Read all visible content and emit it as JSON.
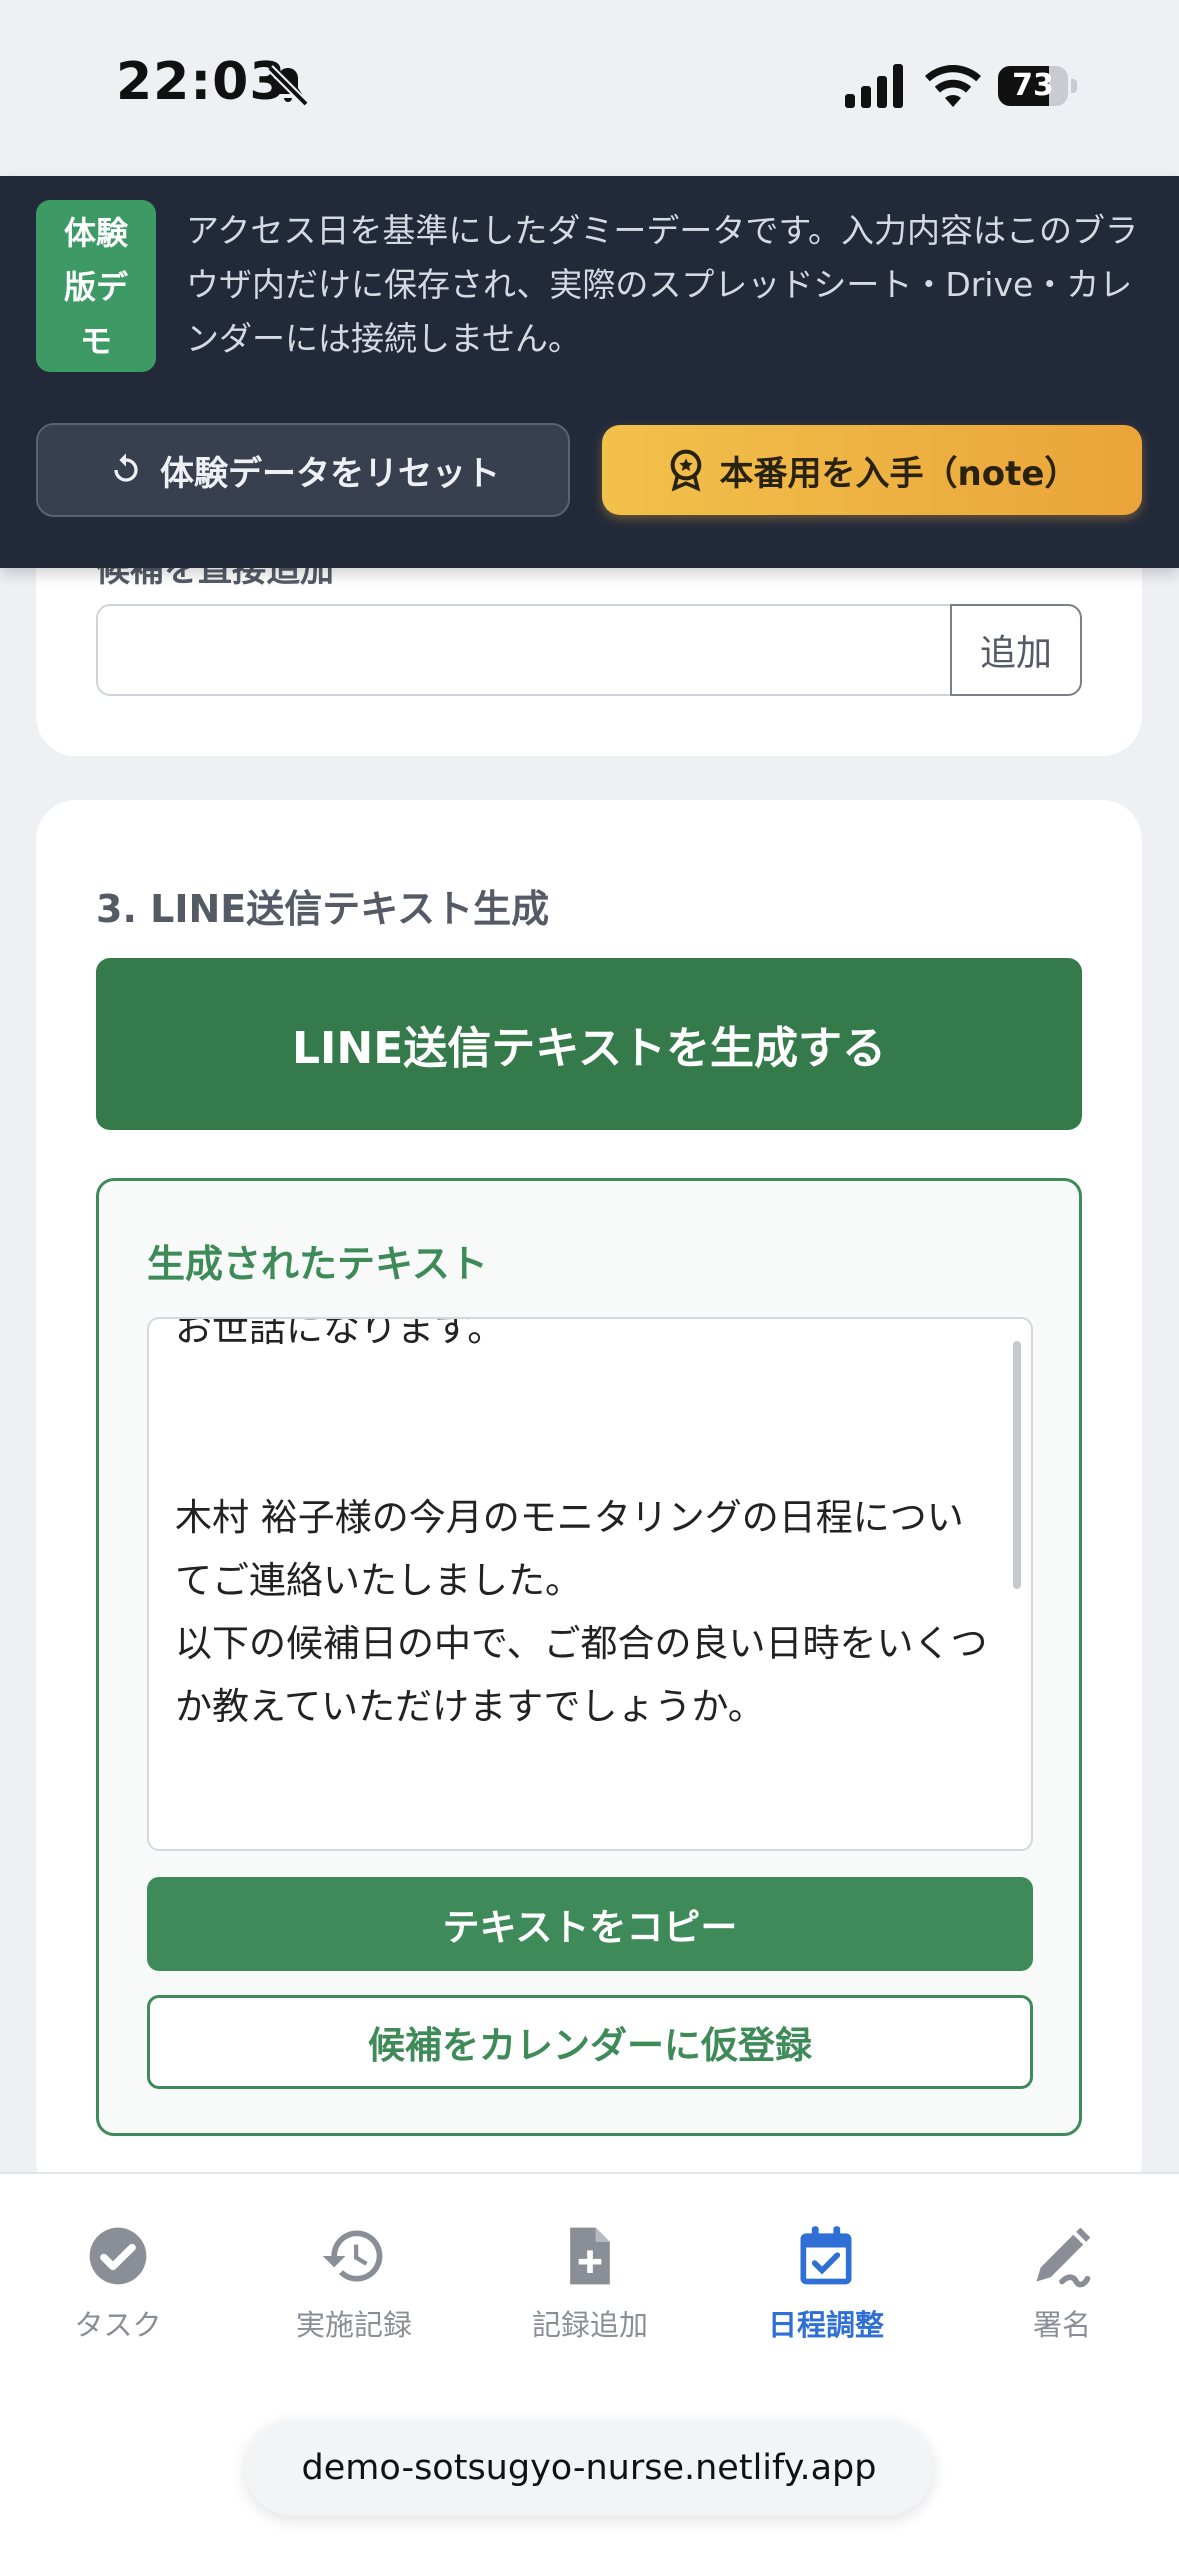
{
  "status_bar": {
    "time": "22:03",
    "battery": "73",
    "battery_level": 0.73
  },
  "banner": {
    "badge": [
      "体験",
      "版デ",
      "モ"
    ],
    "message": "アクセス日を基準にしたダミーデータです。入力内容はこのブラウザ内だけに保存され、実際のスプレッドシート・Drive・カレンダーには接続しません。",
    "reset_label": "体験データをリセット",
    "note_label": "本番用を入手（note）"
  },
  "card_add": {
    "label": "候補を直接追加",
    "input_value": "",
    "add_label": "追加"
  },
  "line_section": {
    "title": "3. LINE送信テキスト生成",
    "generate_label": "LINE送信テキストを生成する",
    "result_title": "生成されたテキスト",
    "generated_text": "お世話になります。\n\n\n木村 裕子様の今月のモニタリングの日程についてご連絡いたしました。\n以下の候補日の中で、ご都合の良い日時をいくつか教えていただけますでしょうか。",
    "copy_label": "テキストをコピー",
    "calendar_label": "候補をカレンダーに仮登録"
  },
  "bottom_nav": {
    "items": [
      {
        "label": "タスク",
        "icon": "check-circle-icon"
      },
      {
        "label": "実施記録",
        "icon": "history-icon"
      },
      {
        "label": "記録追加",
        "icon": "file-add-icon"
      },
      {
        "label": "日程調整",
        "icon": "calendar-check-icon",
        "active": true
      },
      {
        "label": "署名",
        "icon": "signature-icon"
      }
    ]
  },
  "browser": {
    "url": "demo-sotsugyo-nurse.netlify.app"
  },
  "colors": {
    "green": "#3f8a59",
    "banner_bg": "#222a3a",
    "accent_orange": "#eaa43a",
    "active_blue": "#2f6fd6"
  }
}
